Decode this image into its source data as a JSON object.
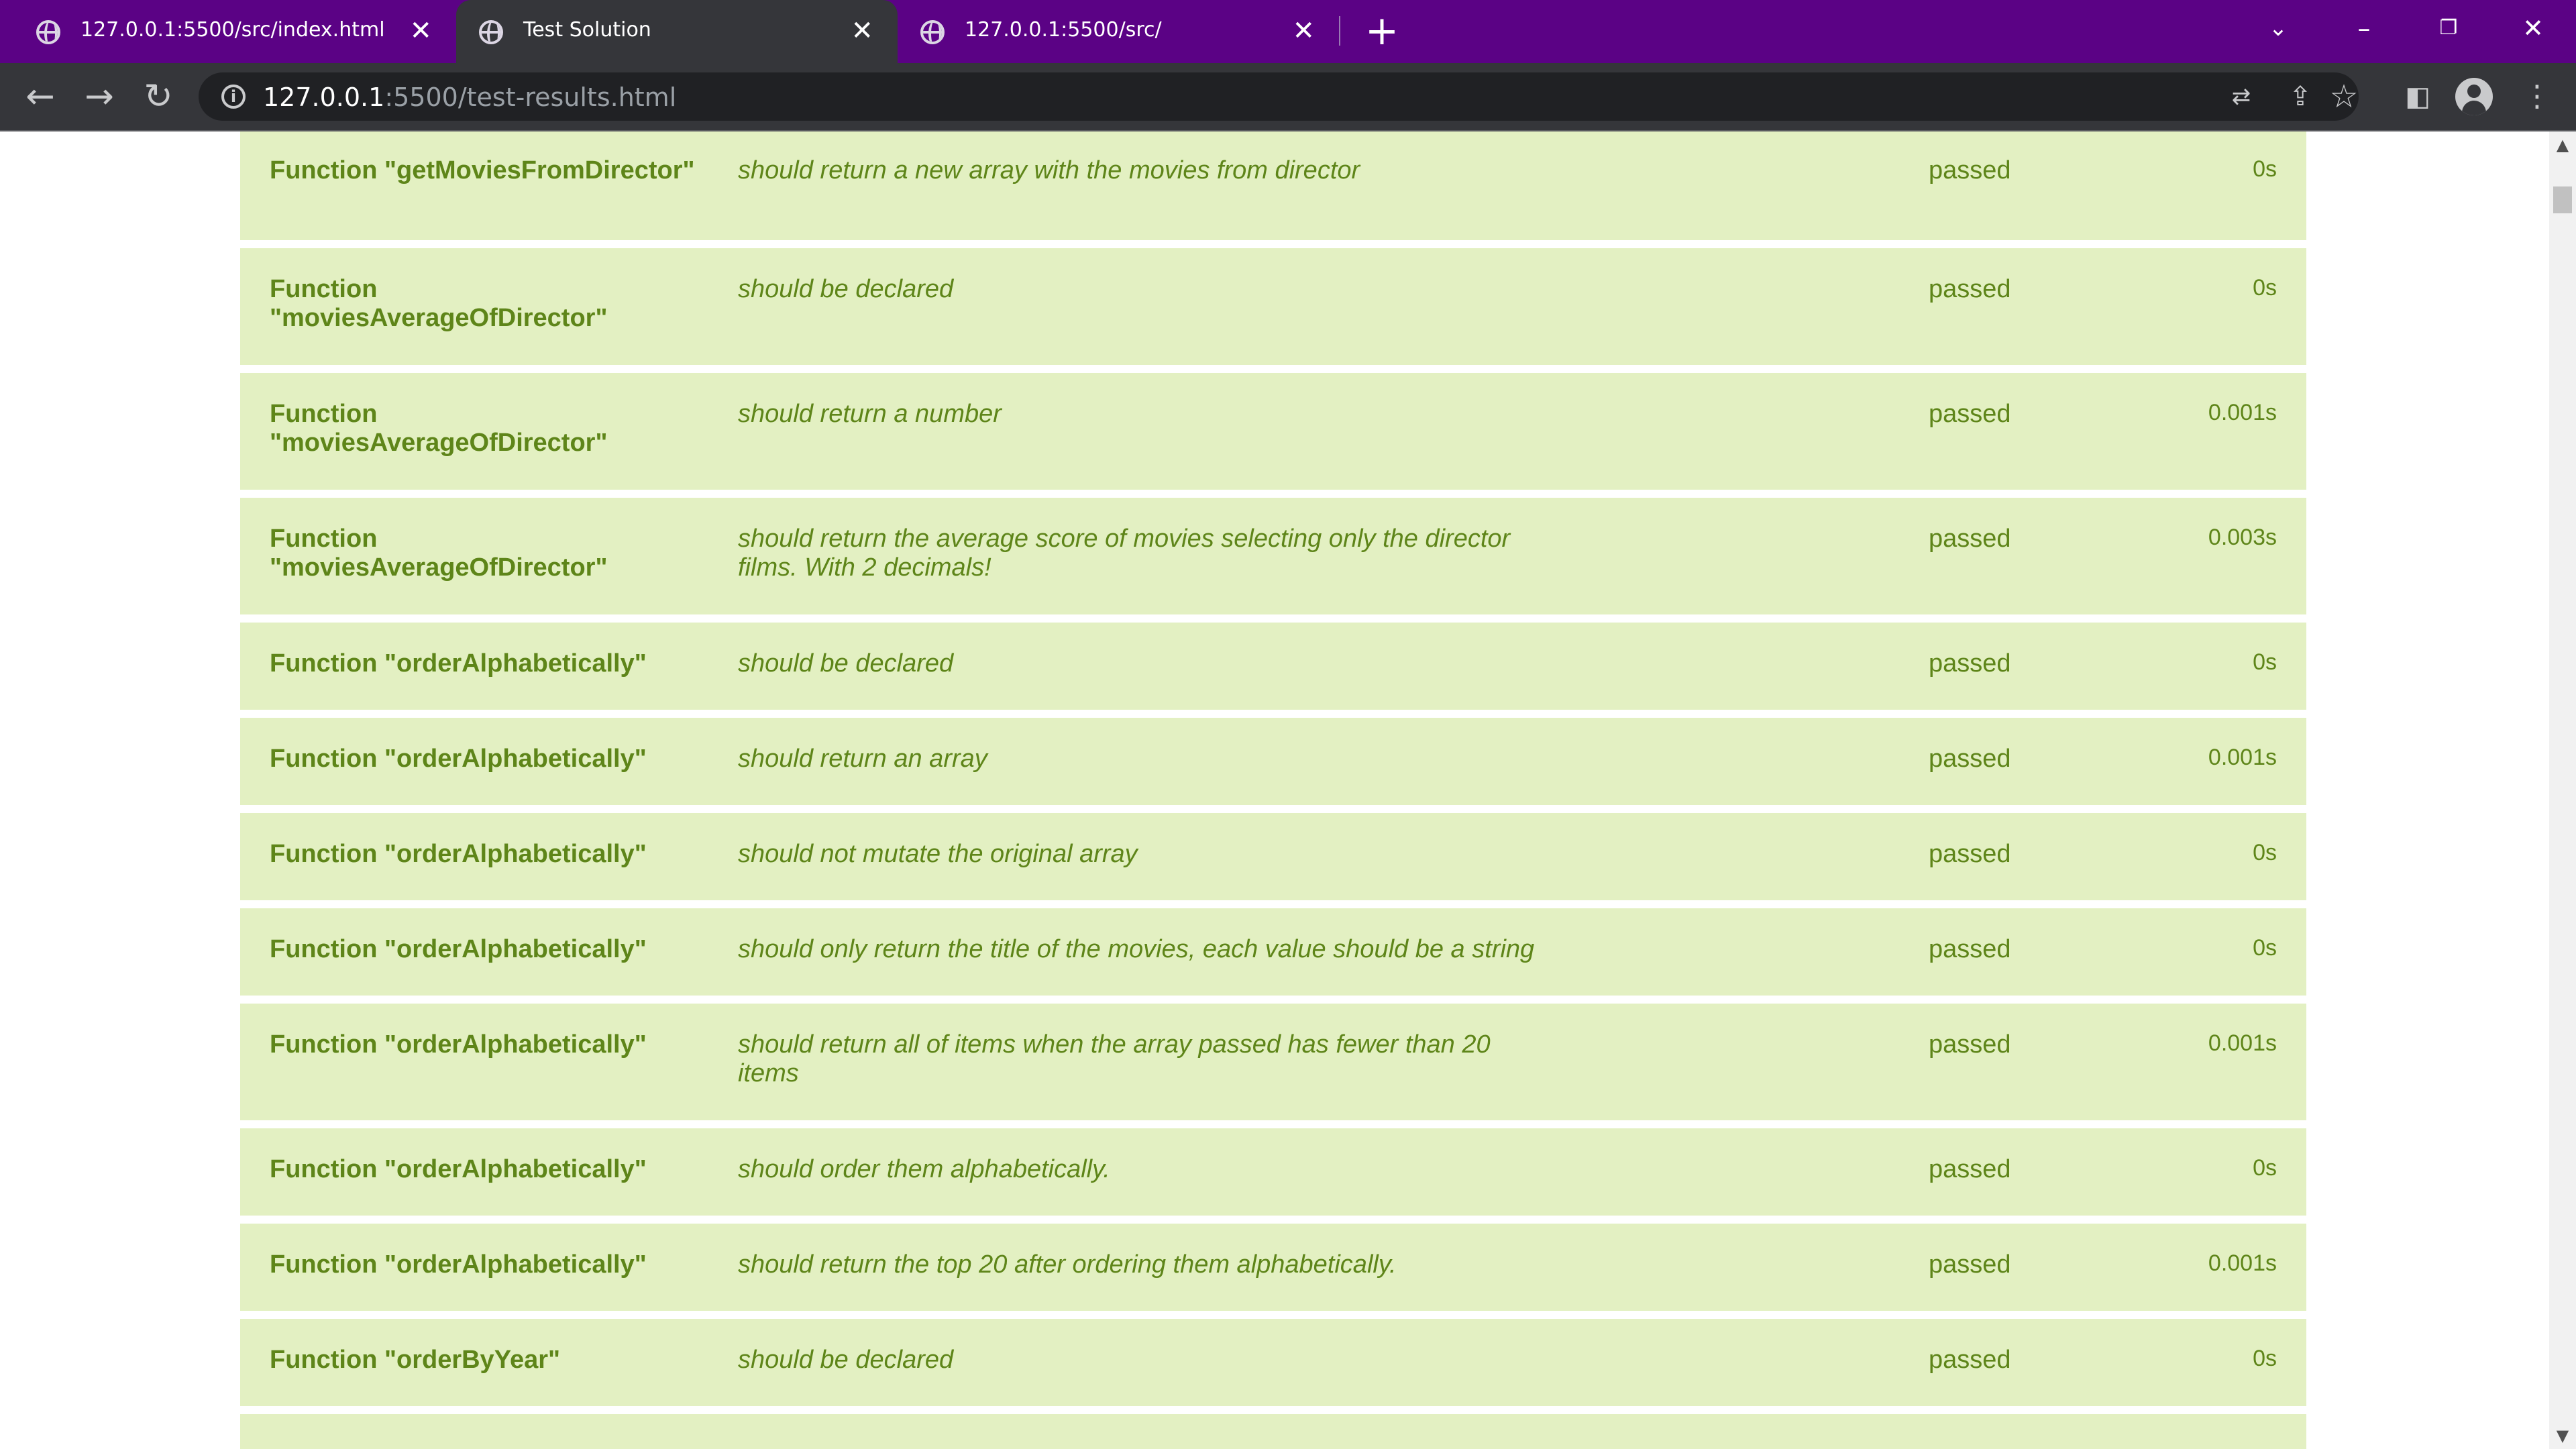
{
  "tabs": [
    {
      "title": "127.0.0.1:5500/src/index.html",
      "active": false
    },
    {
      "title": "Test Solution",
      "active": true
    },
    {
      "title": "127.0.0.1:5500/src/",
      "active": false
    }
  ],
  "omnibox": {
    "host": "127.0.0.1",
    "rest": ":5500/test-results.html"
  },
  "colors": {
    "tabstrip": "#5b0285",
    "toolbar": "#35363a",
    "row_bg": "#e3f0c2",
    "row_text": "#5e8519"
  },
  "results": [
    {
      "suite": "Function \"getMoviesFromDirector\"",
      "description": "should return a new array with the movies from director",
      "status": "passed",
      "duration": "0s"
    },
    {
      "suite": "Function \"moviesAverageOfDirector\"",
      "description": "should be declared",
      "status": "passed",
      "duration": "0s"
    },
    {
      "suite": "Function \"moviesAverageOfDirector\"",
      "description": "should return a number",
      "status": "passed",
      "duration": "0.001s"
    },
    {
      "suite": "Function \"moviesAverageOfDirector\"",
      "description": "should return the average score of movies selecting only the director films. With 2 decimals!",
      "status": "passed",
      "duration": "0.003s"
    },
    {
      "suite": "Function \"orderAlphabetically\"",
      "description": "should be declared",
      "status": "passed",
      "duration": "0s"
    },
    {
      "suite": "Function \"orderAlphabetically\"",
      "description": "should return an array",
      "status": "passed",
      "duration": "0.001s"
    },
    {
      "suite": "Function \"orderAlphabetically\"",
      "description": "should not mutate the original array",
      "status": "passed",
      "duration": "0s"
    },
    {
      "suite": "Function \"orderAlphabetically\"",
      "description": "should only return the title of the movies, each value should be a string",
      "status": "passed",
      "duration": "0s"
    },
    {
      "suite": "Function \"orderAlphabetically\"",
      "description": "should return all of items when the array passed has fewer than 20 items",
      "status": "passed",
      "duration": "0.001s"
    },
    {
      "suite": "Function \"orderAlphabetically\"",
      "description": "should order them alphabetically.",
      "status": "passed",
      "duration": "0s"
    },
    {
      "suite": "Function \"orderAlphabetically\"",
      "description": "should return the top 20 after ordering them alphabetically.",
      "status": "passed",
      "duration": "0.001s"
    },
    {
      "suite": "Function \"orderByYear\"",
      "description": "should be declared",
      "status": "passed",
      "duration": "0s"
    }
  ]
}
